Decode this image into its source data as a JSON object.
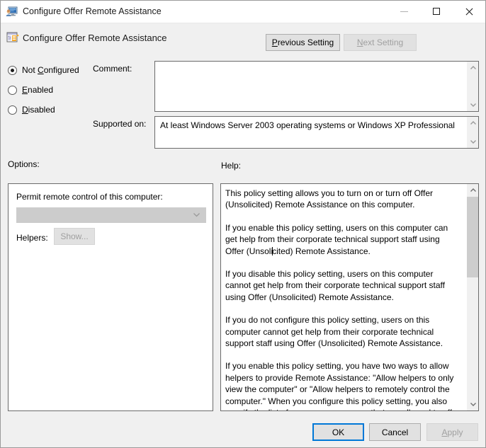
{
  "window": {
    "title": "Configure Offer Remote Assistance",
    "title_icon": "remote-assistance-monitor-icon",
    "controls": {
      "minimize": "minimize-icon",
      "maximize": "maximize-icon",
      "close": "close-icon"
    }
  },
  "header": {
    "icon": "policy-setting-icon",
    "title": "Configure Offer Remote Assistance",
    "previous_setting": "Previous Setting",
    "previous_accel": "P",
    "next_setting": "Next Setting",
    "next_accel": "N",
    "next_enabled": false
  },
  "state": {
    "options": [
      {
        "id": "not-configured",
        "label_before": "Not ",
        "accel": "C",
        "label_after": "onfigured",
        "selected": true
      },
      {
        "id": "enabled",
        "label_before": "",
        "accel": "E",
        "label_after": "nabled",
        "selected": false
      },
      {
        "id": "disabled",
        "label_before": "",
        "accel": "D",
        "label_after": "isabled",
        "selected": false
      }
    ]
  },
  "comment": {
    "label": "Comment:",
    "value": ""
  },
  "supported": {
    "label": "Supported on:",
    "value": "At least Windows Server 2003 operating systems or Windows XP Professional"
  },
  "options_panel": {
    "label": "Options:",
    "permit_label": "Permit remote control of this computer:",
    "permit_value": "",
    "permit_enabled": false,
    "helpers_label": "Helpers:",
    "show_button": "Show...",
    "show_enabled": false
  },
  "help": {
    "label": "Help:",
    "paragraphs": [
      "This policy setting allows you to turn on or turn off Offer (Unsolicited) Remote Assistance on this computer.",
      "If you enable this policy setting, users on this computer can get help from their corporate technical support staff using Offer (Unsolicited) Remote Assistance.",
      "If you disable this policy setting, users on this computer cannot get help from their corporate technical support staff using Offer (Unsolicited) Remote Assistance.",
      "If you do not configure this policy setting, users on this computer cannot get help from their corporate technical support staff using Offer (Unsolicited) Remote Assistance.",
      "If you enable this policy setting, you have two ways to allow helpers to provide Remote Assistance: \"Allow helpers to only view the computer\" or \"Allow helpers to remotely control the computer.\" When you configure this policy setting, you also specify the list of users or user groups that are allowed to offer remote assistance."
    ]
  },
  "footer": {
    "ok": "OK",
    "cancel": "Cancel",
    "apply": "Apply",
    "apply_accel": "A",
    "apply_enabled": false
  },
  "colors": {
    "window_background": "#f0f0f0",
    "titlebar_background": "#ffffff",
    "default_button_border": "#0078d7",
    "button_face": "#e1e1e1",
    "disabled_text": "#a0a0a0",
    "field_border": "#6b6b6b",
    "scrollbar_thumb": "#cdcdcd",
    "disabled_combo": "#cccccc"
  }
}
